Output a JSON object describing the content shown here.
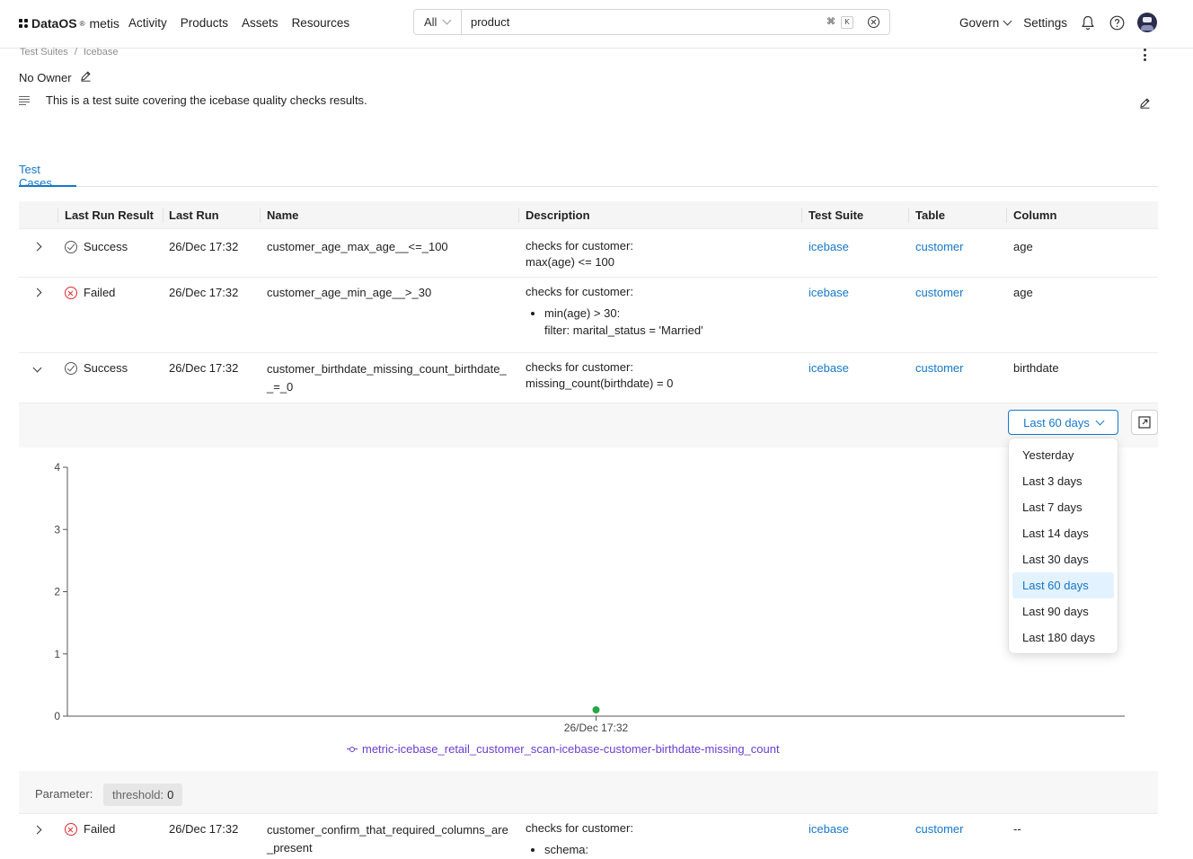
{
  "app": {
    "brand": "DataOS",
    "brand_mark": "®",
    "product": "metis"
  },
  "nav": {
    "links": [
      "Activity",
      "Products",
      "Assets",
      "Resources"
    ],
    "govern": "Govern",
    "settings": "Settings"
  },
  "search": {
    "scope": "All",
    "query": "product",
    "shortcut_cmd": "⌘",
    "shortcut_key": "K"
  },
  "breadcrumb": [
    "Test Suites",
    "Icebase"
  ],
  "breadcrumb_sep": "/",
  "owner": "No Owner",
  "description": "This is a test suite covering the icebase quality checks results.",
  "tabs": [
    "Test Cases"
  ],
  "table": {
    "columns": [
      "Last Run Result",
      "Last Run",
      "Name",
      "Description",
      "Test Suite",
      "Table",
      "Column"
    ],
    "rows": [
      {
        "status": "Success",
        "last_run": "26/Dec 17:32",
        "name": "customer_age_max_age__<=_100",
        "desc_line1": "checks for customer:",
        "desc_line2": "max(age) <= 100",
        "suite": "icebase",
        "table": "customer",
        "column": "age"
      },
      {
        "status": "Failed",
        "last_run": "26/Dec 17:32",
        "name": "customer_age_min_age__>_30",
        "desc_line1": "checks for customer:",
        "desc_bullet1": "min(age) > 30:",
        "desc_bullet2": "filter: marital_status = 'Married'",
        "suite": "icebase",
        "table": "customer",
        "column": "age"
      },
      {
        "status": "Success",
        "last_run": "26/Dec 17:32",
        "name_line1": "customer_birthdate_missing_count_birthdate_",
        "name_line2": "_=_0",
        "desc_line1": "checks for customer:",
        "desc_line2": "missing_count(birthdate) = 0",
        "suite": "icebase",
        "table": "customer",
        "column": "birthdate"
      },
      {
        "status": "Failed",
        "last_run": "26/Dec 17:32",
        "name_line1": "customer_confirm_that_required_columns_are",
        "name_line2": "_present",
        "desc_line1": "checks for customer:",
        "desc_bullet1": "schema:",
        "suite": "icebase",
        "table": "customer",
        "column": "--"
      }
    ]
  },
  "date_range": {
    "selected": "Last 60 days",
    "options": [
      "Yesterday",
      "Last 3 days",
      "Last 7 days",
      "Last 14 days",
      "Last 30 days",
      "Last 60 days",
      "Last 90 days",
      "Last 180 days"
    ]
  },
  "chart_data": {
    "type": "line",
    "x": [
      "26/Dec 17:32"
    ],
    "series": [
      {
        "name": "metric-icebase_retail_customer_scan-icebase-customer-birthdate-missing_count",
        "values": [
          0
        ],
        "color": "#6a3fd0"
      }
    ],
    "y_ticks": [
      "0",
      "1",
      "2",
      "3",
      "4"
    ],
    "ylim": [
      0,
      4
    ],
    "point_color": "#28a745",
    "legend_position": "bottom"
  },
  "parameter": {
    "label": "Parameter:",
    "key": "threshold:",
    "value": "0"
  },
  "colors": {
    "accent": "#1677c9",
    "failed": "#e0282e",
    "series": "#6a3fd0",
    "point": "#28a745"
  }
}
